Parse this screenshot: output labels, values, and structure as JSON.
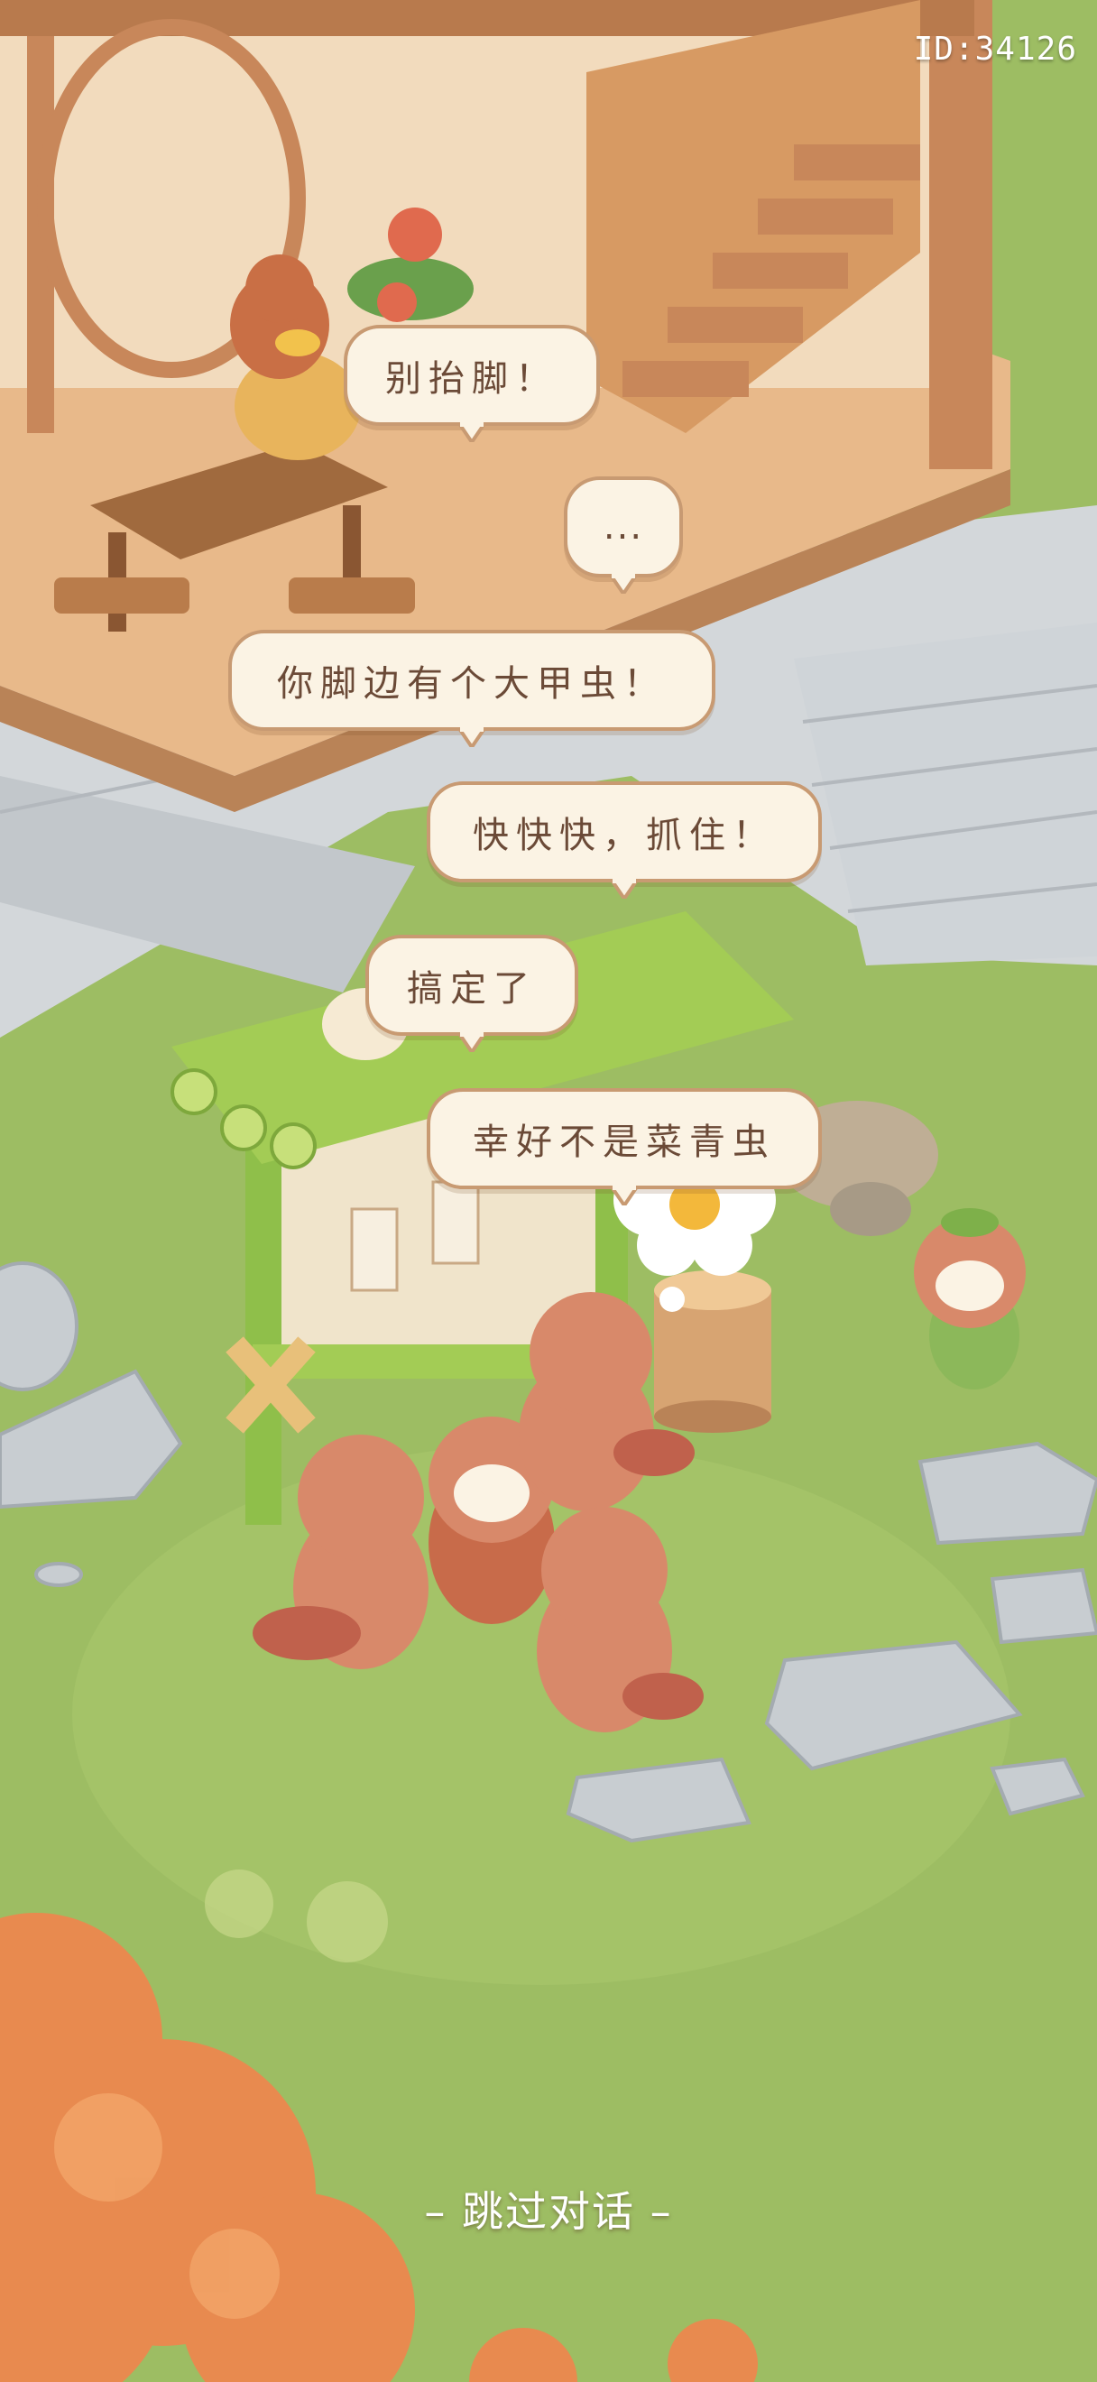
{
  "hud": {
    "player_id": "ID:34126"
  },
  "dialogue": [
    {
      "text": "别抬脚！"
    },
    {
      "text": "..."
    },
    {
      "text": "你脚边有个大甲虫！"
    },
    {
      "text": "快快快，抓住！"
    },
    {
      "text": "搞定了"
    },
    {
      "text": "幸好不是菜青虫"
    }
  ],
  "controls": {
    "skip_label": "– 跳过对话 –"
  },
  "icons": {
    "flower_thought": "flower-thought-icon"
  }
}
